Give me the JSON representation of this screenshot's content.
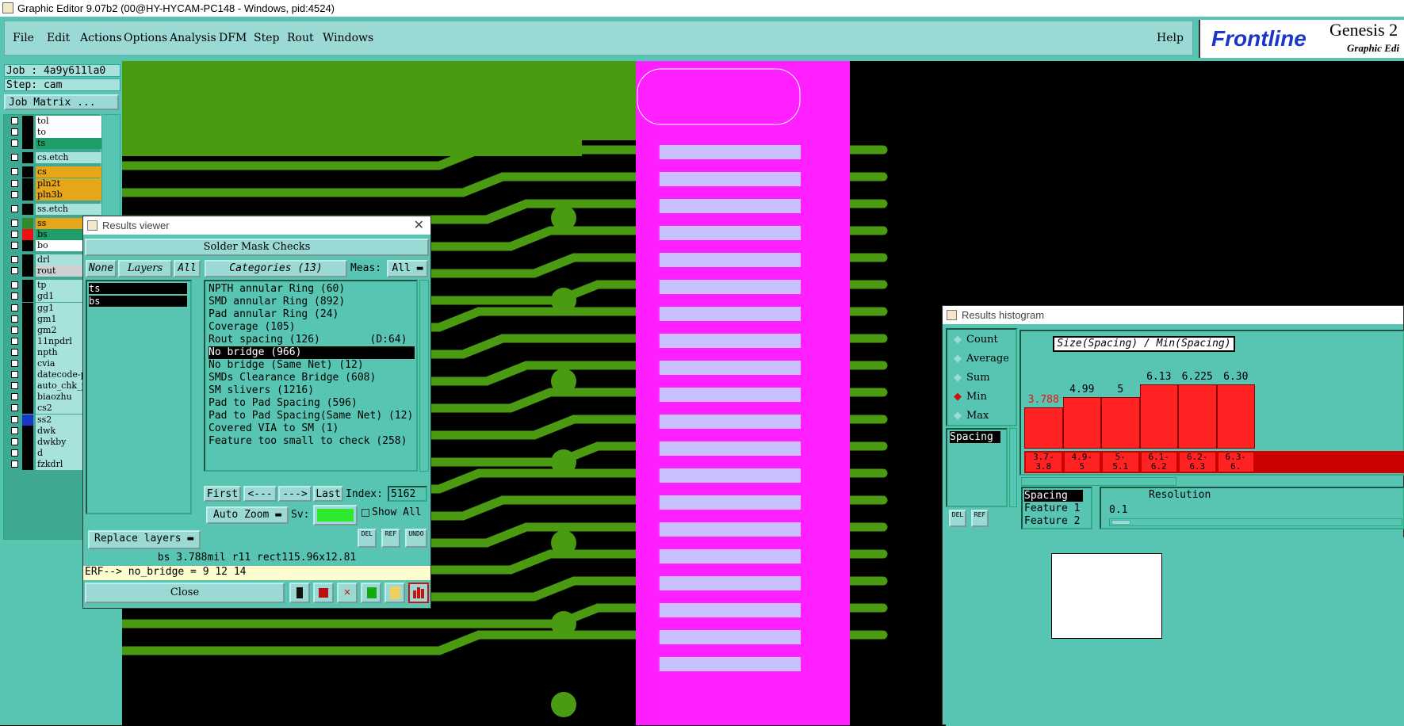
{
  "window": {
    "title": "Graphic Editor 9.07b2 (00@HY-HYCAM-PC148 - Windows, pid:4524)"
  },
  "menu": {
    "items": [
      "File",
      "Edit",
      "Actions",
      "Options",
      "Analysis",
      "DFM",
      "Step",
      "Rout",
      "Windows"
    ],
    "help": "Help",
    "brand": "Frontline",
    "product": "Genesis 2",
    "product_sub": "Graphic Edi"
  },
  "job": {
    "job_line": "Job : 4a9y611la0",
    "step_line": "Step: cam",
    "matrix_button": "Job Matrix ..."
  },
  "layers": [
    {
      "name": "tol",
      "color": "#ffffff",
      "swatch": "#000000"
    },
    {
      "name": "to",
      "color": "#ffffff",
      "swatch": "#000000"
    },
    {
      "name": "ts",
      "color": "#1f9e6a",
      "swatch": "#000000"
    },
    {
      "name": "cs.etch",
      "color": "#a8e2dc",
      "swatch": "#000000"
    },
    {
      "name": "cs",
      "color": "#e6a61a",
      "swatch": "#000000"
    },
    {
      "name": "pln2t",
      "color": "#e6a61a",
      "swatch": "#000000"
    },
    {
      "name": "pln3b",
      "color": "#e6a61a",
      "swatch": "#000000"
    },
    {
      "name": "ss.etch",
      "color": "#a8e2dc",
      "swatch": "#000000"
    },
    {
      "name": "ss",
      "color": "#e6a61a",
      "swatch": "#2e8b2e"
    },
    {
      "name": "bs",
      "color": "#1f9e6a",
      "swatch": "#e11"
    },
    {
      "name": "bo",
      "color": "#ffffff",
      "swatch": "#000000"
    },
    {
      "name": "drl",
      "color": "#a8e2dc",
      "swatch": "#000000"
    },
    {
      "name": "rout",
      "color": "#d0d0d0",
      "swatch": "#000000"
    },
    {
      "name": "tp",
      "color": "#a8e2dc",
      "swatch": "#000000"
    },
    {
      "name": "gd1",
      "color": "#a8e2dc",
      "swatch": "#000000"
    },
    {
      "name": "gg1",
      "color": "#a8e2dc",
      "swatch": "#000000"
    },
    {
      "name": "gm1",
      "color": "#a8e2dc",
      "swatch": "#000000"
    },
    {
      "name": "gm2",
      "color": "#a8e2dc",
      "swatch": "#000000"
    },
    {
      "name": "11npdrl",
      "color": "#a8e2dc",
      "swatch": "#000000"
    },
    {
      "name": "npth",
      "color": "#a8e2dc",
      "swatch": "#000000"
    },
    {
      "name": "cvia",
      "color": "#a8e2dc",
      "swatch": "#000000"
    },
    {
      "name": "datecode-pt",
      "color": "#a8e2dc",
      "swatch": "#000000"
    },
    {
      "name": "auto_chk_pr",
      "color": "#a8e2dc",
      "swatch": "#000000"
    },
    {
      "name": "biaozhu",
      "color": "#a8e2dc",
      "swatch": "#000000"
    },
    {
      "name": "cs2",
      "color": "#a8e2dc",
      "swatch": "#000000"
    },
    {
      "name": "ss2",
      "color": "#a8e2dc",
      "swatch": "#1b37c9"
    },
    {
      "name": "dwk",
      "color": "#a8e2dc",
      "swatch": "#000000"
    },
    {
      "name": "dwkby",
      "color": "#a8e2dc",
      "swatch": "#000000"
    },
    {
      "name": "d",
      "color": "#a8e2dc",
      "swatch": "#000000"
    },
    {
      "name": "fzkdrl",
      "color": "#a8e2dc",
      "swatch": "#000000"
    }
  ],
  "results_viewer": {
    "title": "Results viewer",
    "header": "Solder Mask Checks",
    "none_btn": "None",
    "layers_btn": "Layers",
    "all_btn": "All",
    "categories_btn": "Categories (13)",
    "meas_label": "Meas:",
    "meas_value": "All",
    "layers_list": [
      "ts",
      "bs"
    ],
    "categories": [
      "NPTH annular Ring (60)",
      "SMD annular Ring (892)",
      "Pad annular Ring (24)",
      "Coverage (105)",
      "Rout spacing (126)        (D:64)",
      "No bridge (966)",
      "No bridge (Same Net) (12)",
      "SMDs Clearance Bridge (608)",
      "SM slivers (1216)",
      "Pad to Pad Spacing (596)",
      "Pad to Pad Spacing(Same Net) (12)",
      "Covered VIA to SM (1)",
      "Feature too small to check (258)"
    ],
    "first_btn": "First",
    "prev_btn": "<---",
    "next_btn": "--->",
    "last_btn": "Last",
    "index_label": "Index:",
    "index_value": "5162",
    "auto_zoom": "Auto Zoom",
    "sv_label": "Sv:",
    "show_all": "Show All",
    "replace_layers": "Replace layers",
    "del_btn": "DEL",
    "ref_btn": "REF",
    "undo_btn": "UNDO",
    "status1": "bs 3.788mil  r11  rect115.96x12.81",
    "status2": "ERF--> no_bridge = 9 12 14",
    "close_btn": "Close"
  },
  "histogram": {
    "title": "Results histogram",
    "options": [
      "Count",
      "Average",
      "Sum",
      "Min",
      "Max"
    ],
    "selected_option": "Min",
    "heading": "Size(Spacing) / Min(Spacing)",
    "list": [
      "Spacing"
    ],
    "bars": [
      {
        "value": "3.788",
        "range": "3.7-\n3.8",
        "level": 0.52
      },
      {
        "value": "4.99",
        "range": "4.9-\n5",
        "level": 0.65
      },
      {
        "value": "5",
        "range": "5-\n5.1",
        "level": 0.65
      },
      {
        "value": "6.13",
        "range": "6.1-\n6.2",
        "level": 0.81
      },
      {
        "value": "6.225",
        "range": "6.2-\n6.3",
        "level": 0.81
      },
      {
        "value": "6.30",
        "range": "6.3-\n6.",
        "level": 0.81
      }
    ],
    "feature_list": [
      "Spacing",
      "Feature 1",
      "Feature 2"
    ],
    "resolution_label": "Resolution",
    "resolution_value": "0.1",
    "del_btn": "DEL",
    "ref_btn": "REF"
  },
  "colors": {
    "teal": "#58c4b2",
    "light_teal": "#9ad9d4",
    "pcb_green": "#4a9a12",
    "magenta": "#ff1fff",
    "lavender": "#c8c0ff",
    "bar_red": "#ff2222"
  }
}
